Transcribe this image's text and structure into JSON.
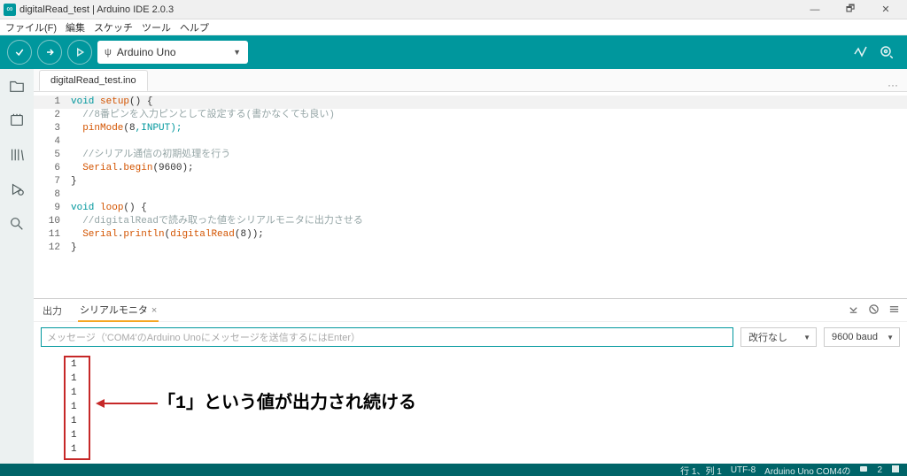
{
  "window": {
    "title": "digitalRead_test | Arduino IDE 2.0.3"
  },
  "menu": {
    "file": "ファイル(F)",
    "edit": "編集",
    "sketch": "スケッチ",
    "tool": "ツール",
    "help": "ヘルプ"
  },
  "toolbar": {
    "board": "Arduino Uno"
  },
  "tabs": {
    "file": "digitalRead_test.ino"
  },
  "code": {
    "l1a": "void",
    "l1b": "setup",
    "l1c": "() {",
    "l2": "//8番ピンを入力ピンとして設定する(書かなくても良い)",
    "l3a": "pinMode",
    "l3b": "(",
    "l3c": "8",
    "l3d": ",INPUT);",
    "l5": "//シリアル通信の初期処理を行う",
    "l6a": "Serial",
    "l6b": ".",
    "l6c": "begin",
    "l6d": "(",
    "l6e": "9600",
    "l6f": ");",
    "l7": "}",
    "l9a": "void",
    "l9b": "loop",
    "l9c": "() {",
    "l10": "//digitalReadで読み取った値をシリアルモニタに出力させる",
    "l11a": "Serial",
    "l11b": ".",
    "l11c": "println",
    "l11d": "(",
    "l11e": "digitalRead",
    "l11f": "(",
    "l11g": "8",
    "l11h": "));",
    "l12": "}"
  },
  "gutter": [
    "1",
    "2",
    "3",
    "4",
    "5",
    "6",
    "7",
    "8",
    "9",
    "10",
    "11",
    "12"
  ],
  "bottom": {
    "tab_output": "出力",
    "tab_serial": "シリアルモニタ",
    "msg_placeholder": "メッセージ（'COM4'のArduino Unoにメッセージを送信するにはEnter）",
    "line_ending": "改行なし",
    "baud": "9600 baud"
  },
  "serial_values": [
    "1",
    "1",
    "1",
    "1",
    "1",
    "1",
    "1"
  ],
  "annotation": "「1」という値が出力され続ける",
  "status": {
    "pos": "行 1、列 1",
    "enc": "UTF-8",
    "board": "Arduino Uno COM4の",
    "notif": "2"
  }
}
